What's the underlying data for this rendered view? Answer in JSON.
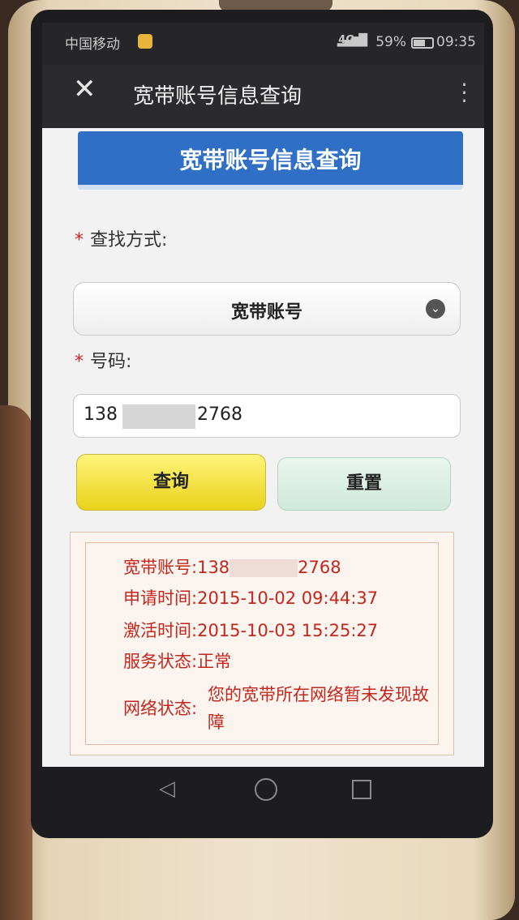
{
  "status_bar": {
    "carrier": "中国移动",
    "network": "4G",
    "battery": "59%",
    "time": "09:35"
  },
  "title_bar": {
    "title": "宽带账号信息查询"
  },
  "banner": {
    "title": "宽带账号信息查询"
  },
  "form": {
    "search_method_label": "查找方式:",
    "search_method_value": "宽带账号",
    "number_label": "号码:",
    "number_prefix": "138",
    "number_suffix": "2768",
    "query_label": "查询",
    "reset_label": "重置"
  },
  "result": {
    "account_key": "宽带账号:",
    "account_prefix": "138",
    "account_suffix": "2768",
    "apply_key": "申请时间:",
    "apply_value": "2015-10-02 09:44:37",
    "activate_key": "激活时间:",
    "activate_value": "2015-10-03 15:25:27",
    "service_key": "服务状态:",
    "service_value": "正常",
    "network_key": "网络状态:",
    "network_value": "您的宽带所在网络暂未发现故障"
  },
  "colors": {
    "banner": "#2f6fc6",
    "query_button": "#f3e23a",
    "reset_button": "#d9efe3",
    "result_text": "#c2271e"
  }
}
